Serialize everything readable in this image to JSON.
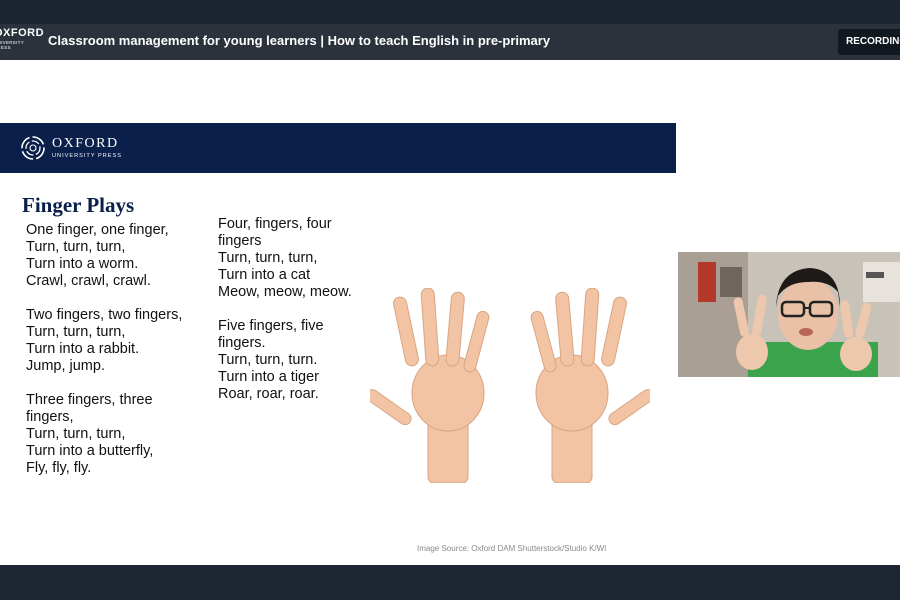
{
  "titlebar": {
    "brand_line1": "OXFORD",
    "brand_line2": "UNIVERSITY PRESS",
    "session_title": "Classroom management for young learners | How to teach English in pre-primary",
    "recording_label": "RECORDING"
  },
  "slide": {
    "logo_line1": "OXFORD",
    "logo_line2": "UNIVERSITY PRESS",
    "heading": "Finger Plays",
    "column1": [
      [
        "One finger, one finger,",
        "Turn, turn, turn,",
        "Turn into a worm.",
        "Crawl, crawl, crawl."
      ],
      [
        "Two fingers, two fingers,",
        "Turn, turn, turn,",
        "Turn into a rabbit.",
        "Jump, jump."
      ],
      [
        "Three fingers, three fingers,",
        "Turn, turn, turn,",
        "Turn into a butterfly,",
        "Fly, fly, fly."
      ]
    ],
    "column2": [
      [
        "Four, fingers, four fingers",
        "Turn, turn, turn,",
        "Turn into a cat",
        "Meow, meow, meow."
      ],
      [
        "Five fingers, five fingers.",
        "Turn, turn, turn.",
        "Turn into a tiger",
        "Roar, roar, roar."
      ]
    ],
    "image_source": "Image Source: Oxford DAM Shutterstock/Studio K/WI",
    "header_color": "#0a1f4a",
    "skin_color": "#f2c4a4"
  },
  "icons": {
    "oup_logo": "oup-swirl-logo-icon",
    "hands": "open-hands-image",
    "webcam": "presenter-webcam-feed"
  }
}
